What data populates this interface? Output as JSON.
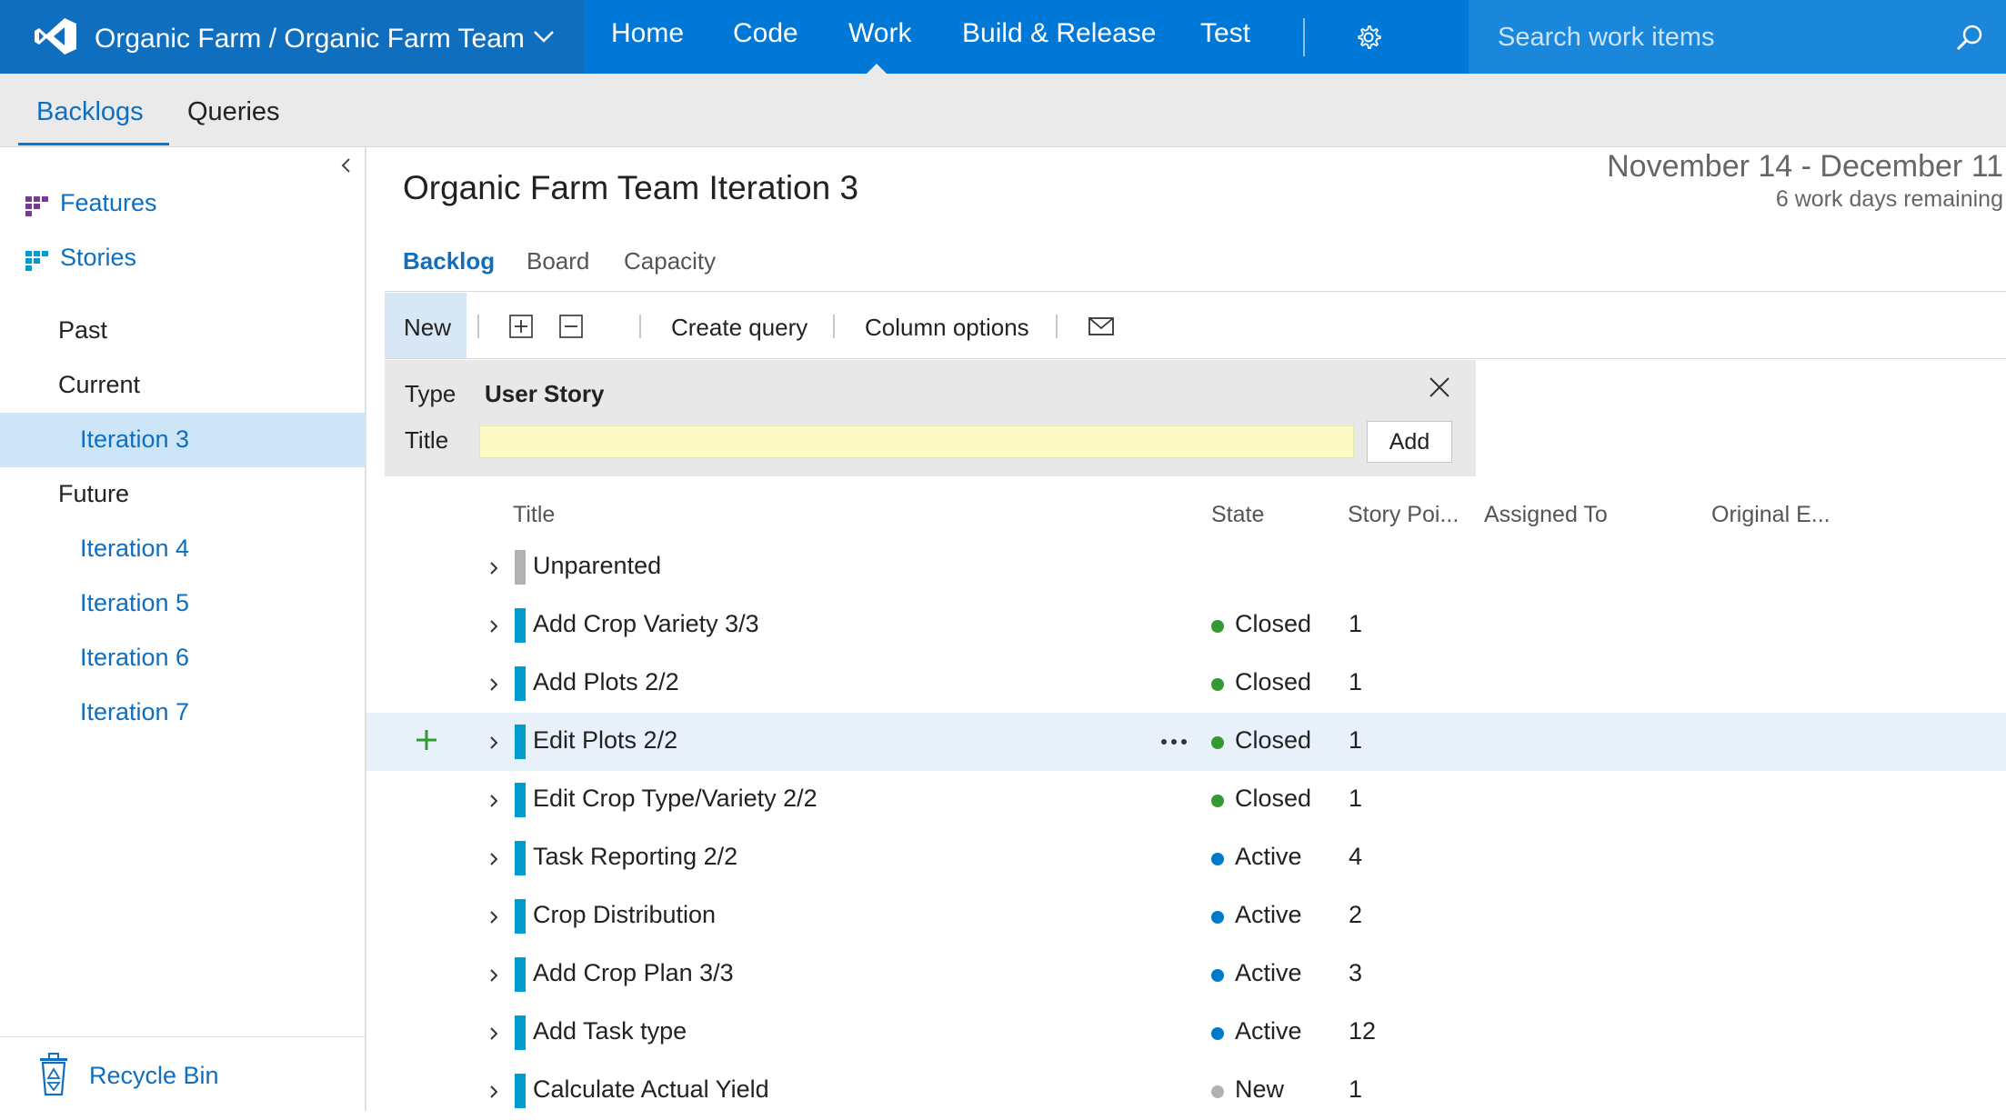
{
  "colors": {
    "topbar": "#0078d7",
    "brand_bg": "#106ebe",
    "link": "#106ebe",
    "feature_purple": "#773b93",
    "story_blue": "#009ccc",
    "closed_green": "#339933",
    "active_blue": "#007acc",
    "new_gray": "#b2b2b2"
  },
  "topbar": {
    "project_title": "Organic Farm / Organic Farm Team",
    "nav": [
      "Home",
      "Code",
      "Work",
      "Build & Release",
      "Test"
    ],
    "active_nav": "Work",
    "search_placeholder": "Search work items"
  },
  "subnav": {
    "tabs": [
      "Backlogs",
      "Queries"
    ],
    "active_tab": "Backlogs"
  },
  "sidebar": {
    "backlog_levels": [
      "Features",
      "Stories"
    ],
    "past": "Past",
    "current": "Current",
    "current_iteration": "Iteration 3",
    "future": "Future",
    "future_iterations": [
      "Iteration 4",
      "Iteration 5",
      "Iteration 6",
      "Iteration 7"
    ],
    "recycle_bin": "Recycle Bin"
  },
  "header": {
    "title": "Organic Farm Team Iteration 3",
    "date_range": "November 14 - December 11",
    "work_days": "6 work days remaining"
  },
  "pivots": [
    "Backlog",
    "Board",
    "Capacity"
  ],
  "toolbar": {
    "new_label": "New",
    "create_query": "Create query",
    "column_options": "Column options"
  },
  "add_panel": {
    "type_label": "Type",
    "type_value": "User Story",
    "title_label": "Title",
    "title_value": "",
    "add_label": "Add"
  },
  "columns": [
    "Title",
    "State",
    "Story Poi...",
    "Assigned To",
    "Original E..."
  ],
  "rows": [
    {
      "title": "Unparented",
      "state": "",
      "points": "",
      "kind": "unparented"
    },
    {
      "title": "Add Crop Variety 3/3",
      "state": "Closed",
      "points": "1",
      "kind": "story"
    },
    {
      "title": "Add Plots 2/2",
      "state": "Closed",
      "points": "1",
      "kind": "story"
    },
    {
      "title": "Edit Plots 2/2",
      "state": "Closed",
      "points": "1",
      "kind": "story"
    },
    {
      "title": "Edit Crop Type/Variety 2/2",
      "state": "Closed",
      "points": "1",
      "kind": "story"
    },
    {
      "title": "Task Reporting 2/2",
      "state": "Active",
      "points": "4",
      "kind": "story"
    },
    {
      "title": "Crop Distribution",
      "state": "Active",
      "points": "2",
      "kind": "story"
    },
    {
      "title": "Add Crop Plan 3/3",
      "state": "Active",
      "points": "3",
      "kind": "story"
    },
    {
      "title": "Add Task type",
      "state": "Active",
      "points": "12",
      "kind": "story"
    },
    {
      "title": "Calculate Actual Yield",
      "state": "New",
      "points": "1",
      "kind": "story"
    }
  ]
}
